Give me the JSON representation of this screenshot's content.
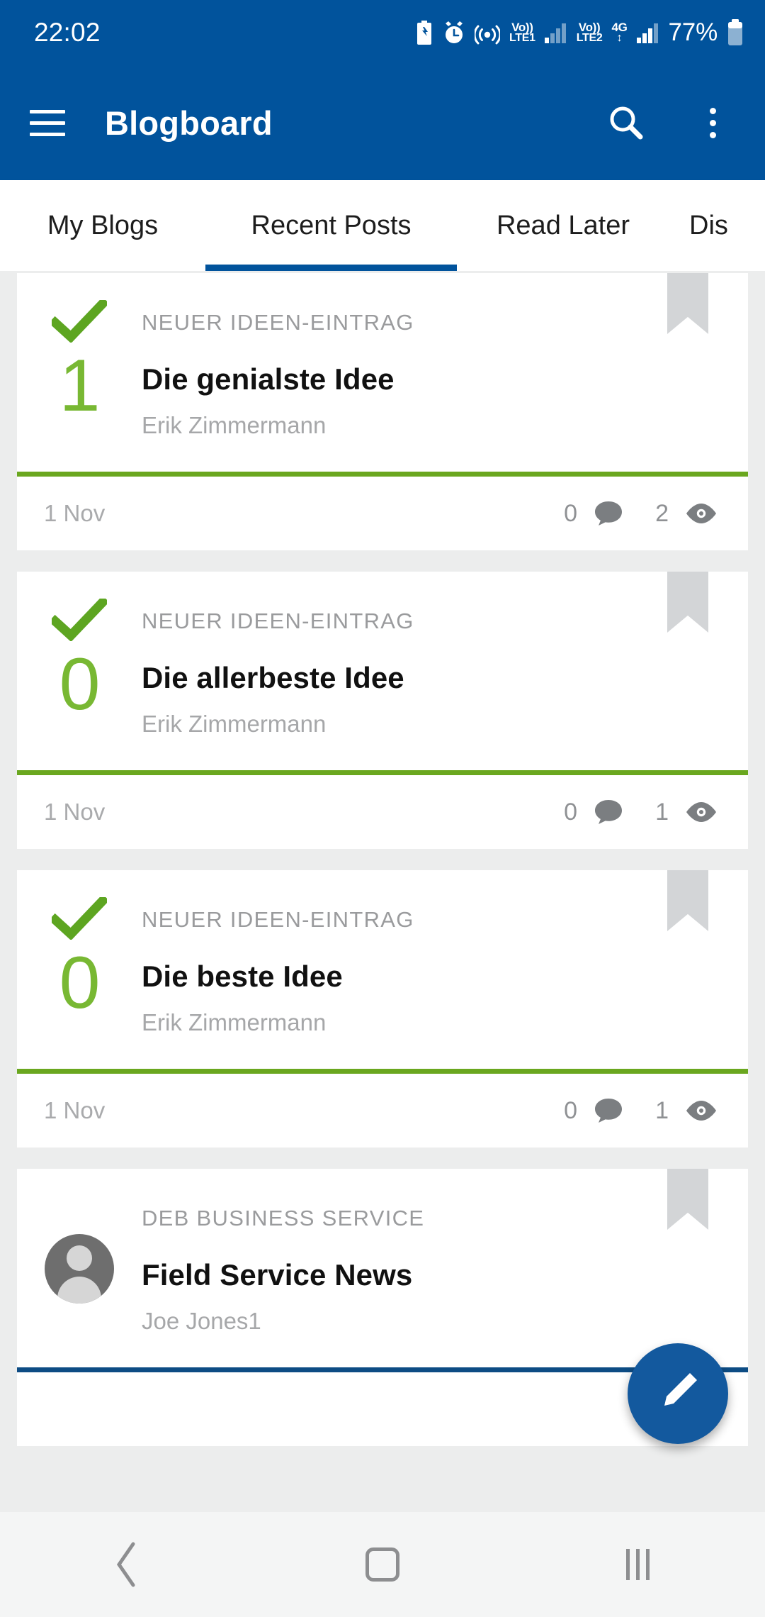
{
  "status_bar": {
    "clock": "22:02",
    "battery_text": "77%",
    "network": {
      "volte1": "Vo))",
      "lte1": "LTE1",
      "volte2": "Vo))",
      "lte2": "LTE2",
      "data": "4G"
    },
    "icons": [
      "battery-saver-icon",
      "alarm-icon",
      "hotspot-icon",
      "volte-lte1-icon",
      "signal-bars-icon",
      "volte-lte2-icon",
      "4g-data-icon",
      "signal-bars-2-icon",
      "battery-icon"
    ]
  },
  "app_bar": {
    "title": "Blogboard",
    "menu_icon": "hamburger-menu-icon",
    "search_icon": "search-icon",
    "overflow_icon": "kebab-menu-icon",
    "background_color": "#01539c"
  },
  "tabs": {
    "items": [
      {
        "label": "My Blogs",
        "active": false
      },
      {
        "label": "Recent Posts",
        "active": true
      },
      {
        "label": "Read Later",
        "active": false
      },
      {
        "label": "Dis",
        "active": false
      }
    ],
    "indicator_color": "#01539c"
  },
  "posts": [
    {
      "eyebrow": "NEUER IDEEN-EINTRAG",
      "title": "Die genialste Idee",
      "author": "Erik Zimmermann",
      "rank": "1",
      "date": "1 Nov",
      "comments": "0",
      "views": "2",
      "leading": "rank",
      "accent_color": "#6aa71f",
      "bookmarked": false
    },
    {
      "eyebrow": "NEUER IDEEN-EINTRAG",
      "title": "Die allerbeste Idee",
      "author": "Erik Zimmermann",
      "rank": "0",
      "date": "1 Nov",
      "comments": "0",
      "views": "1",
      "leading": "rank",
      "accent_color": "#6aa71f",
      "bookmarked": false
    },
    {
      "eyebrow": "NEUER IDEEN-EINTRAG",
      "title": "Die beste Idee",
      "author": "Erik Zimmermann",
      "rank": "0",
      "date": "1 Nov",
      "comments": "0",
      "views": "1",
      "leading": "rank",
      "accent_color": "#6aa71f",
      "bookmarked": false
    },
    {
      "eyebrow": "DEB BUSINESS SERVICE",
      "title": "Field Service News",
      "author": "Joe Jones1",
      "rank": "",
      "date": "",
      "comments": "",
      "views": "",
      "leading": "avatar",
      "accent_color": "#0d4c84",
      "bookmarked": false
    }
  ],
  "fab": {
    "icon": "pencil-edit-icon",
    "color": "#13599e"
  },
  "nav_bar": {
    "back_icon": "back-chevron-icon",
    "home_icon": "home-square-icon",
    "recents_icon": "recents-bars-icon"
  },
  "theme": {
    "primary": "#01539c",
    "green_accent": "#6aa71f",
    "green_text": "#78b833",
    "page_bg": "#eceded",
    "card_bg": "#ffffff",
    "muted_text": "#a6a7a9"
  }
}
